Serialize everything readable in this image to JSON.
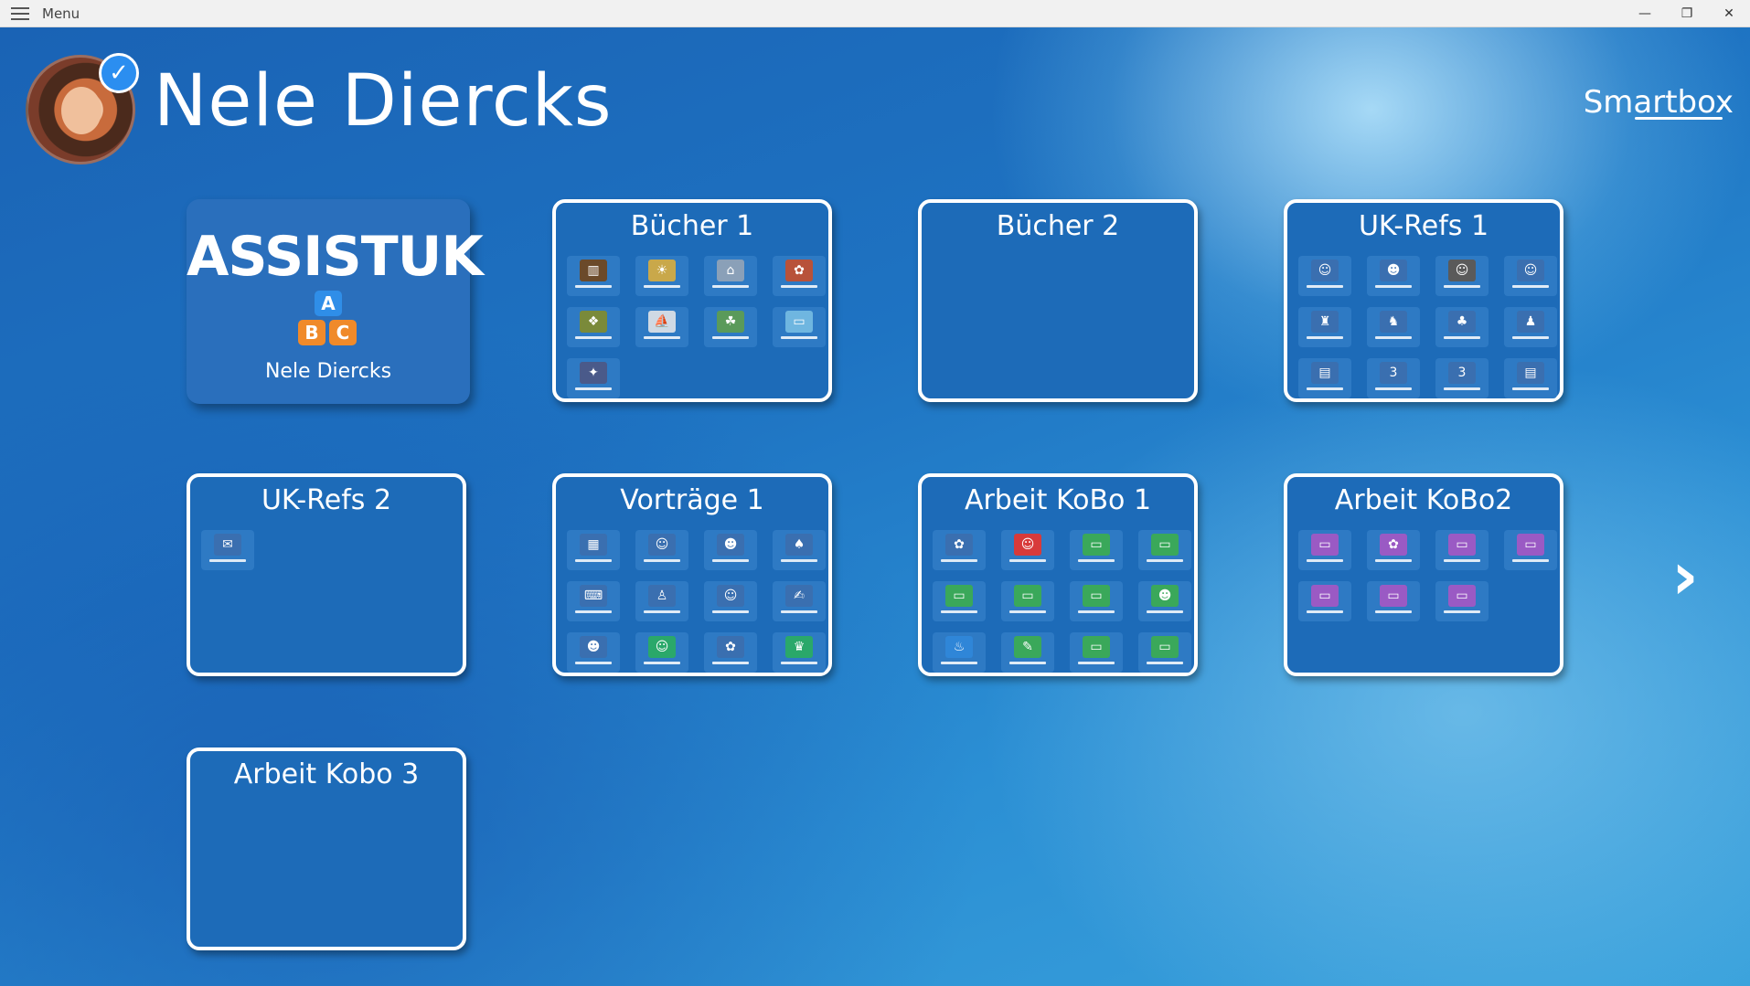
{
  "window": {
    "menu_label": "Menu",
    "controls": [
      "—",
      "❐",
      "✕"
    ]
  },
  "header": {
    "user_name": "Nele Diercks",
    "brand": "Smartbox"
  },
  "logo_tile": {
    "logo_text": "ASSISTUK",
    "blocks": [
      "A",
      "B",
      "C"
    ],
    "name": "Nele Diercks"
  },
  "tiles": [
    {
      "title": "Bücher 1",
      "thumbs": [
        {
          "c": "#6b4a2a",
          "g": "▥"
        },
        {
          "c": "#c9a84a",
          "g": "☀"
        },
        {
          "c": "#8aa0b8",
          "g": "⌂"
        },
        {
          "c": "#b8523a",
          "g": "✿"
        },
        {
          "c": "#7a8a3a",
          "g": "❖"
        },
        {
          "c": "#cfd9e4",
          "g": "⛵"
        },
        {
          "c": "#5a9a5a",
          "g": "☘"
        },
        {
          "c": "#6fb6e0",
          "g": "▭"
        },
        {
          "c": "#4a5a8a",
          "g": "✦"
        }
      ]
    },
    {
      "title": "Bücher 2",
      "thumbs": []
    },
    {
      "title": "UK-Refs 1",
      "thumbs": [
        {
          "c": "#3a6fb0",
          "g": "☺"
        },
        {
          "c": "#3a6fb0",
          "g": "☻"
        },
        {
          "c": "#5a5a5a",
          "g": "☺"
        },
        {
          "c": "#3a6fb0",
          "g": "☺"
        },
        {
          "c": "#3a6fb0",
          "g": "♜"
        },
        {
          "c": "#3a6fb0",
          "g": "♞"
        },
        {
          "c": "#3a6fb0",
          "g": "♣"
        },
        {
          "c": "#3a6fb0",
          "g": "♟"
        },
        {
          "c": "#3a6fb0",
          "g": "▤"
        },
        {
          "c": "#3a6fb0",
          "g": "3"
        },
        {
          "c": "#3a6fb0",
          "g": "3"
        },
        {
          "c": "#3a6fb0",
          "g": "▤"
        }
      ]
    },
    {
      "title": "UK-Refs 2",
      "thumbs": [
        {
          "c": "#3a6fb0",
          "g": "✉"
        }
      ]
    },
    {
      "title": "Vorträge 1",
      "thumbs": [
        {
          "c": "#3a6fb0",
          "g": "▦"
        },
        {
          "c": "#3a6fb0",
          "g": "☺"
        },
        {
          "c": "#3a6fb0",
          "g": "☻"
        },
        {
          "c": "#3a6fb0",
          "g": "♠"
        },
        {
          "c": "#3a6fb0",
          "g": "⌨"
        },
        {
          "c": "#3a6fb0",
          "g": "♙"
        },
        {
          "c": "#3a6fb0",
          "g": "☺"
        },
        {
          "c": "#3a6fb0",
          "g": "✍"
        },
        {
          "c": "#3a6fb0",
          "g": "☻"
        },
        {
          "c": "#2aa86a",
          "g": "☺"
        },
        {
          "c": "#3a6fb0",
          "g": "✿"
        },
        {
          "c": "#2aa86a",
          "g": "♛"
        }
      ]
    },
    {
      "title": "Arbeit KoBo 1",
      "thumbs": [
        {
          "c": "#3a6fb0",
          "g": "✿"
        },
        {
          "c": "#d83a3a",
          "g": "☺"
        },
        {
          "c": "#3aa85a",
          "g": "▭"
        },
        {
          "c": "#3aa85a",
          "g": "▭"
        },
        {
          "c": "#3aa85a",
          "g": "▭"
        },
        {
          "c": "#3aa85a",
          "g": "▭"
        },
        {
          "c": "#3aa85a",
          "g": "▭"
        },
        {
          "c": "#3aa85a",
          "g": "☻"
        },
        {
          "c": "#2f86d8",
          "g": "♨"
        },
        {
          "c": "#3aa85a",
          "g": "✎"
        },
        {
          "c": "#3aa85a",
          "g": "▭"
        },
        {
          "c": "#3aa85a",
          "g": "▭"
        }
      ]
    },
    {
      "title": "Arbeit KoBo2",
      "thumbs": [
        {
          "c": "#9a5ac4",
          "g": "▭"
        },
        {
          "c": "#9a5ac4",
          "g": "✿"
        },
        {
          "c": "#9a5ac4",
          "g": "▭"
        },
        {
          "c": "#9a5ac4",
          "g": "▭"
        },
        {
          "c": "#9a5ac4",
          "g": "▭"
        },
        {
          "c": "#9a5ac4",
          "g": "▭"
        },
        {
          "c": "#9a5ac4",
          "g": "▭"
        }
      ]
    },
    {
      "title": "Arbeit Kobo 3",
      "thumbs": []
    }
  ],
  "next_arrow": "›"
}
